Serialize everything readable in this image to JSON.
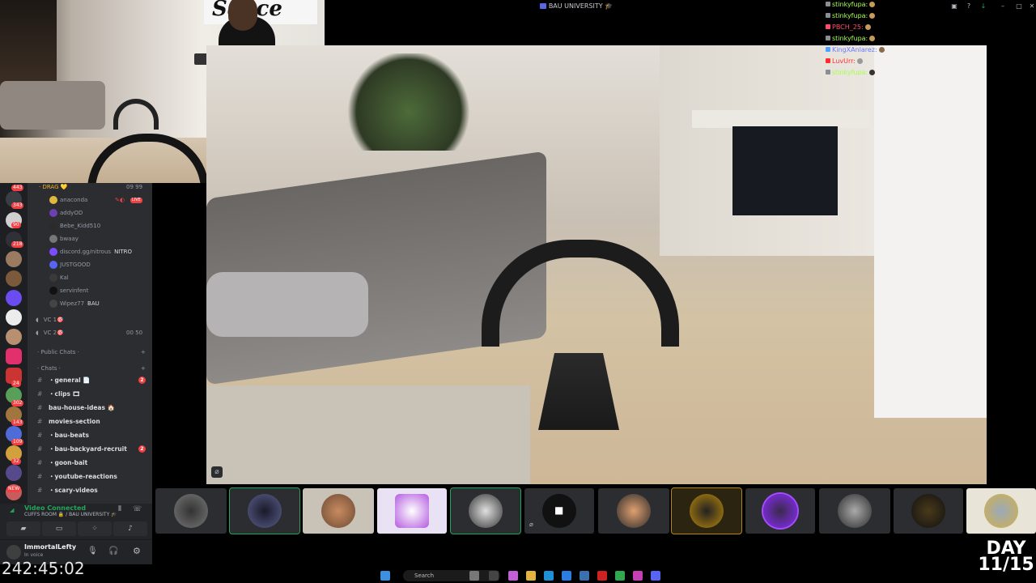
{
  "window": {
    "title": "BAU UNIVERSITY 🎓"
  },
  "webcam": {
    "sign_text": "Sauce"
  },
  "servers": {
    "badges": [
      "443",
      "343",
      "90",
      "218",
      "24",
      "302",
      "143",
      "109",
      "32",
      "NEW"
    ]
  },
  "channels": {
    "category_drag": "· DRAG 💛",
    "drag_counts": "09  99",
    "users": [
      {
        "name": "anaconda",
        "badge": "LIVE"
      },
      {
        "name": "addyOD",
        "badge": ""
      },
      {
        "name": "Bebe_Kidd510",
        "badge": ""
      },
      {
        "name": "bwaay",
        "badge": ""
      },
      {
        "name": "discord.gg/nitrous",
        "badge": "NITRO"
      },
      {
        "name": "JUSTGOOD",
        "badge": ""
      },
      {
        "name": "Kal",
        "badge": ""
      },
      {
        "name": "servinfent",
        "badge": ""
      },
      {
        "name": "Wipez77",
        "badge": "BAU"
      }
    ],
    "vc1": "VC 1🎯",
    "vc2": "VC 2🎯",
    "vc2_counts": "00  50",
    "public_chats": "· Public Chats ·",
    "chats_cat": "· Chats ·",
    "text_channels": [
      {
        "name": "・general 📄",
        "count": "2"
      },
      {
        "name": "・clips 🎞",
        "count": ""
      },
      {
        "name": "bau-house-ideas 🏠",
        "count": ""
      },
      {
        "name": "movies-section",
        "count": ""
      },
      {
        "name": "・bau-beats",
        "count": ""
      },
      {
        "name": "・bau-backyard-recruit",
        "count": "2"
      },
      {
        "name": "・goon-bait",
        "count": ""
      },
      {
        "name": "・youtube-reactions",
        "count": ""
      },
      {
        "name": "・scary-videos",
        "count": ""
      }
    ]
  },
  "voice": {
    "status": "Video Connected",
    "location": "CUFFS ROOM 🔒 / BAU UNIVERSITY 🎓"
  },
  "user": {
    "name": "ImmortalLefty",
    "status": "In voice"
  },
  "chat": [
    {
      "user": "stinkyfupa:",
      "color": "#a6ff4d"
    },
    {
      "user": "stinkyfupa:",
      "color": "#a6ff4d"
    },
    {
      "user": "PBCH_25:",
      "color": "#ff4d6a"
    },
    {
      "user": "stinkyfupa:",
      "color": "#a6ff4d"
    },
    {
      "user": "KingXAnlarez:",
      "color": "#6a7bff"
    },
    {
      "user": "LuvUrr:",
      "color": "#ff2d2d"
    },
    {
      "user": "stinkyfupa:",
      "color": "#a6ff4d"
    }
  ],
  "overlay": {
    "day_label": "DAY",
    "day_value": "11/15",
    "timer": "242:45:02"
  },
  "taskbar": {
    "search_placeholder": "Search"
  }
}
